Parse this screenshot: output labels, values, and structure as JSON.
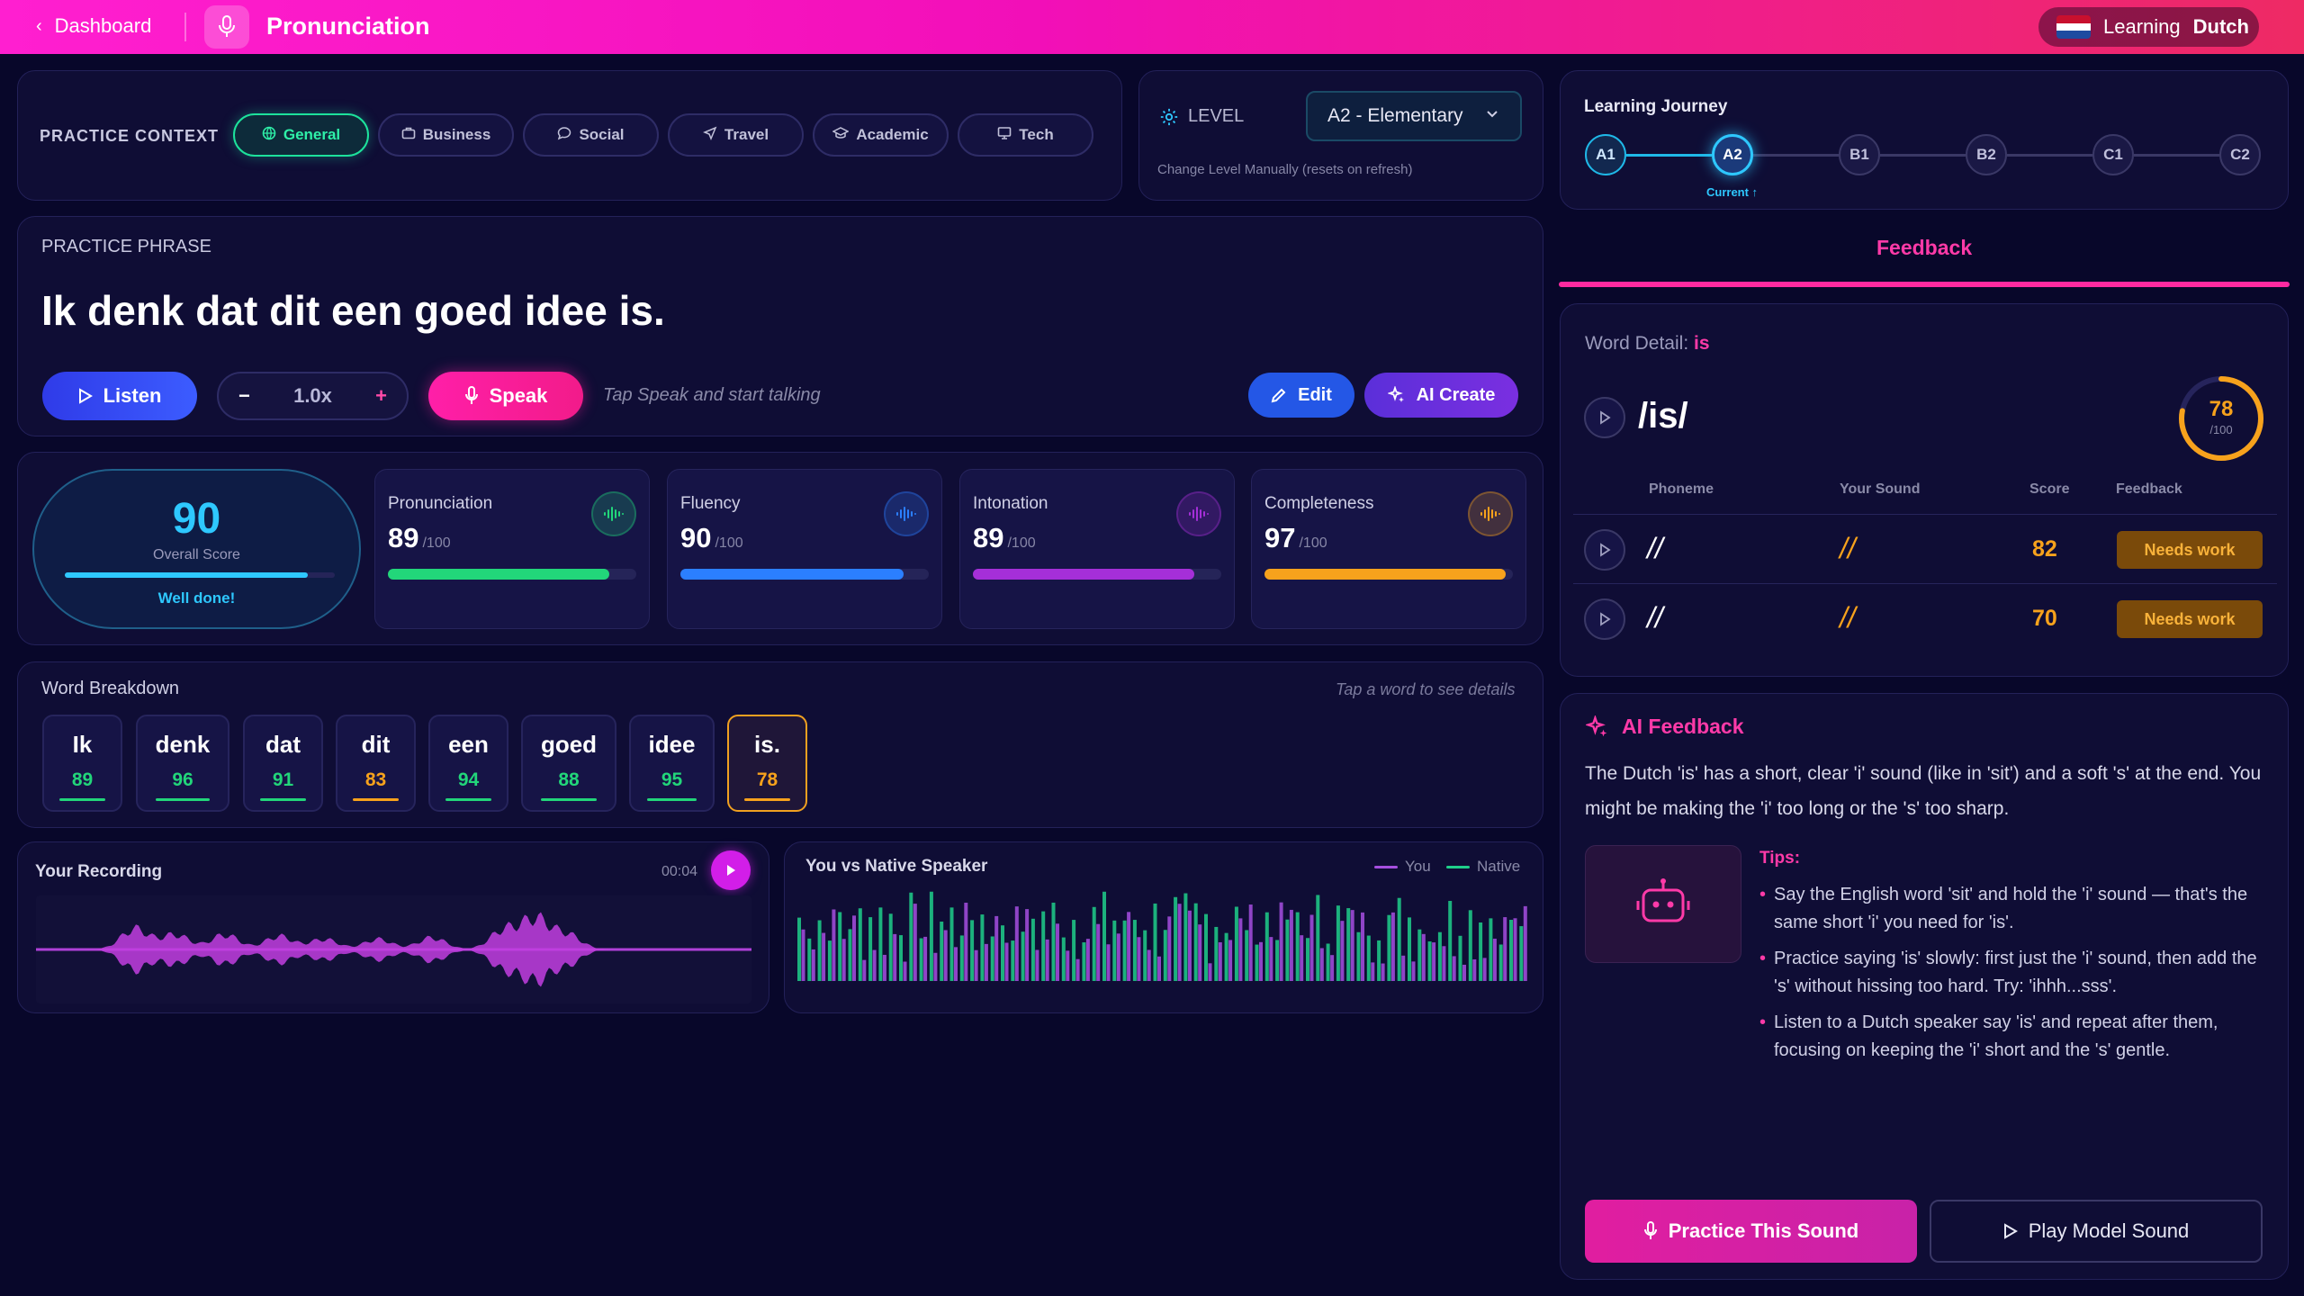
{
  "header": {
    "back_label": "Dashboard",
    "title": "Pronunciation",
    "learning_label": "Learning",
    "language": "Dutch"
  },
  "context": {
    "label": "PRACTICE CONTEXT",
    "chips": [
      {
        "label": "General",
        "icon": "globe-icon",
        "active": true
      },
      {
        "label": "Business",
        "icon": "briefcase-icon",
        "active": false
      },
      {
        "label": "Social",
        "icon": "chat-bubble-icon",
        "active": false
      },
      {
        "label": "Travel",
        "icon": "plane-icon",
        "active": false
      },
      {
        "label": "Academic",
        "icon": "graduation-cap-icon",
        "active": false
      },
      {
        "label": "Tech",
        "icon": "monitor-icon",
        "active": false
      }
    ]
  },
  "level": {
    "label": "LEVEL",
    "selected": "A2 - Elementary",
    "note": "Change Level Manually (resets on refresh)"
  },
  "journey": {
    "title": "Learning Journey",
    "levels": [
      "A1",
      "A2",
      "B1",
      "B2",
      "C1",
      "C2"
    ],
    "current_index": 1,
    "current_label": "Current ↑"
  },
  "feedback_tab": "Feedback",
  "phrase": {
    "label": "PRACTICE PHRASE",
    "text": "Ik denk dat dit een goed idee is.",
    "listen_label": "Listen",
    "speed_minus": "−",
    "speed": "1.0x",
    "speed_plus": "+",
    "speak_label": "Speak",
    "speak_hint": "Tap Speak and start talking",
    "edit_label": "Edit",
    "ai_label": "AI Create"
  },
  "overall": {
    "score": "90",
    "label": "Overall Score",
    "message": "Well done!",
    "fraction": 0.9
  },
  "scores": [
    {
      "name": "Pronunciation",
      "value": "89",
      "max": "/100",
      "fraction": 0.89,
      "color": "#22d67a"
    },
    {
      "name": "Fluency",
      "value": "90",
      "max": "/100",
      "fraction": 0.9,
      "color": "#2b7fff"
    },
    {
      "name": "Intonation",
      "value": "89",
      "max": "/100",
      "fraction": 0.89,
      "color": "#a52fd8"
    },
    {
      "name": "Completeness",
      "value": "97",
      "max": "/100",
      "fraction": 0.97,
      "color": "#f7a21c"
    }
  ],
  "words": {
    "title": "Word Breakdown",
    "hint": "Tap a word to see details",
    "items": [
      {
        "word": "Ik",
        "score": "89",
        "color": "#22d67a"
      },
      {
        "word": "denk",
        "score": "96",
        "color": "#22d67a"
      },
      {
        "word": "dat",
        "score": "91",
        "color": "#22d67a"
      },
      {
        "word": "dit",
        "score": "83",
        "color": "#f7a21c"
      },
      {
        "word": "een",
        "score": "94",
        "color": "#22d67a"
      },
      {
        "word": "goed",
        "score": "88",
        "color": "#22d67a"
      },
      {
        "word": "idee",
        "score": "95",
        "color": "#22d67a"
      },
      {
        "word": "is.",
        "score": "78",
        "color": "#f7a21c"
      }
    ]
  },
  "recording": {
    "title": "Your Recording",
    "time": "00:04"
  },
  "comparison": {
    "title": "You vs Native Speaker",
    "legend_you": "You",
    "legend_native": "Native"
  },
  "word_detail": {
    "title_prefix": "Word Detail:",
    "word": "is",
    "ipa": "/is/",
    "score": "78",
    "score_max": "/100",
    "score_fraction": 0.78,
    "headers": [
      "Phoneme",
      "Your Sound",
      "Score",
      "Feedback"
    ],
    "rows": [
      {
        "phoneme": "//",
        "your": "//",
        "score": "82",
        "feedback": "Needs work"
      },
      {
        "phoneme": "//",
        "your": "//",
        "score": "70",
        "feedback": "Needs work"
      }
    ]
  },
  "ai": {
    "title": "AI Feedback",
    "text": "The Dutch 'is' has a short, clear 'i' sound (like in 'sit') and a soft 's' at the end. You might be making the 'i' too long or the 's' too sharp.",
    "tips_title": "Tips:",
    "tips": [
      "Say the English word 'sit' and hold the 'i' sound — that's the same short 'i' you need for 'is'.",
      "Practice saying 'is' slowly: first just the 'i' sound, then add the 's' without hissing too hard. Try: 'ihhh...sss'.",
      "Listen to a Dutch speaker say 'is' and repeat after them, focusing on keeping the 'i' short and the 's' gentle."
    ]
  },
  "actions": {
    "practice_label": "Practice This Sound",
    "model_label": "Play Model Sound"
  }
}
